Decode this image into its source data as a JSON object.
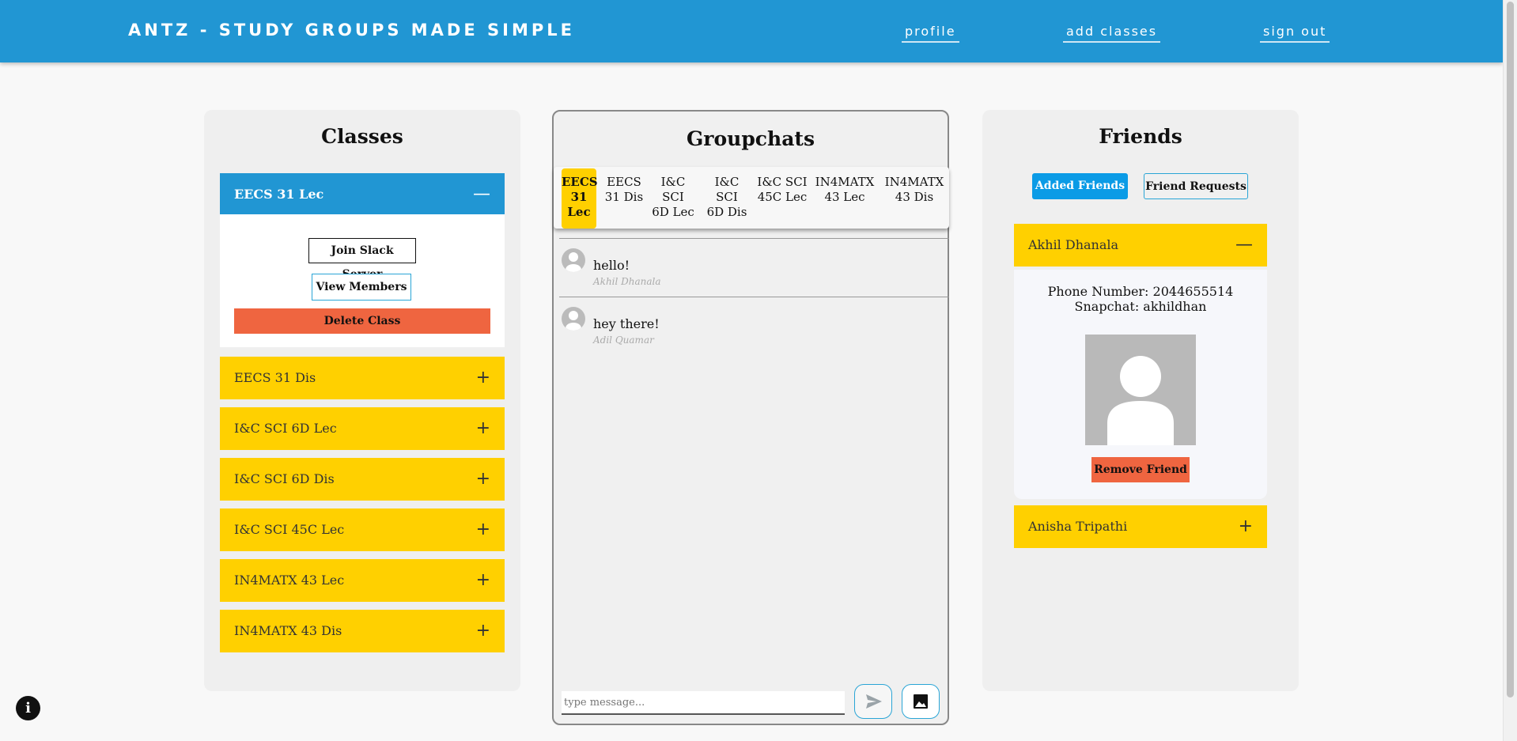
{
  "header": {
    "brand": "ANTZ - STUDY GROUPS MADE SIMPLE",
    "nav": {
      "profile": "profile",
      "add_classes": "add classes",
      "sign_out": "sign out"
    }
  },
  "classes": {
    "title": "Classes",
    "items": [
      {
        "label": "EECS 31 Lec",
        "expanded": true
      },
      {
        "label": "EECS 31 Dis",
        "expanded": false
      },
      {
        "label": "I&C SCI 6D Lec",
        "expanded": false
      },
      {
        "label": "I&C SCI 6D Dis",
        "expanded": false
      },
      {
        "label": "I&C SCI 45C Lec",
        "expanded": false
      },
      {
        "label": "IN4MATX 43 Lec",
        "expanded": false
      },
      {
        "label": "IN4MATX 43 Dis",
        "expanded": false
      }
    ],
    "icons": {
      "expanded": "minus-icon",
      "collapsed": "plus-icon"
    },
    "expanded_actions": {
      "join_slack": "Join Slack Server",
      "view_members": "View Members",
      "delete_class": "Delete Class"
    }
  },
  "groupchats": {
    "title": "Groupchats",
    "tabs": [
      {
        "label": "EECS 31 Lec",
        "active": true
      },
      {
        "label": "EECS 31 Dis",
        "active": false
      },
      {
        "label": "I&C SCI 6D Lec",
        "active": false
      },
      {
        "label": "I&C SCI 6D Dis",
        "active": false
      },
      {
        "label": "I&C SCI 45C Lec",
        "active": false
      },
      {
        "label": "IN4MATX 43 Lec",
        "active": false
      },
      {
        "label": "IN4MATX 43 Dis",
        "active": false
      }
    ],
    "messages": [
      {
        "text": "hello!",
        "author": "Akhil Dhanala"
      },
      {
        "text": "hey there!",
        "author": "Adil Quamar"
      }
    ],
    "input_placeholder": "type message...",
    "send_icon": "send-icon",
    "image_icon": "image-icon"
  },
  "friends": {
    "title": "Friends",
    "tabs": {
      "added": "Added Friends",
      "requests": "Friend Requests"
    },
    "list": [
      {
        "name": "Akhil Dhanala",
        "expanded": true,
        "phone": "Phone Number: 2044655514",
        "snapchat": "Snapchat: akhildhan",
        "remove_label": "Remove Friend"
      },
      {
        "name": "Anisha Tripathi",
        "expanded": false
      }
    ]
  },
  "colors": {
    "header": "#2196d3",
    "accent": "#ffd000",
    "danger": "#ef6540",
    "panel": "#efefef"
  },
  "info_icon": "info-icon"
}
